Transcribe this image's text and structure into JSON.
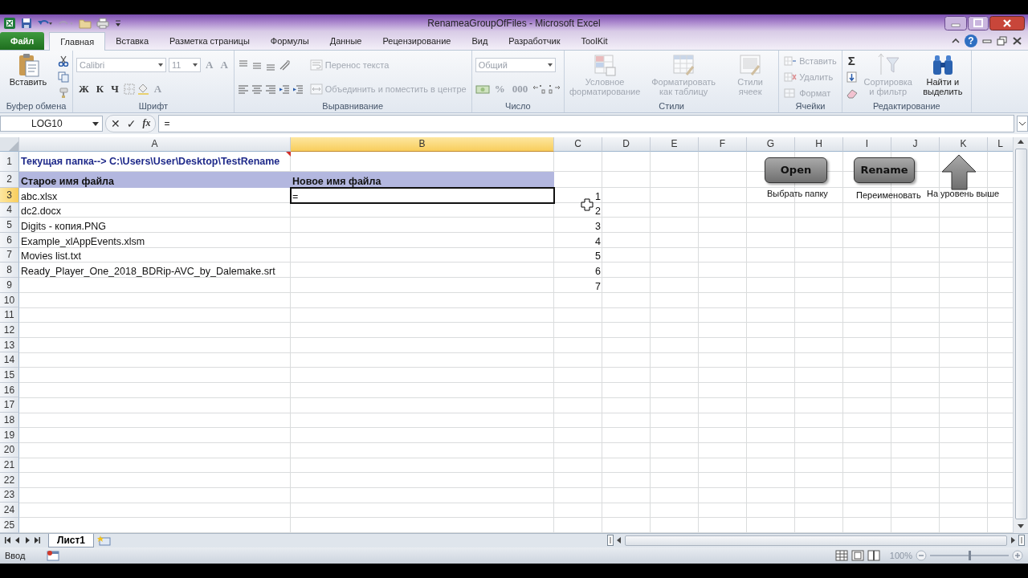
{
  "window": {
    "title": "RenameaGroupOfFiles - Microsoft Excel"
  },
  "ribbon_tabs": [
    {
      "label": "Файл",
      "kind": "file",
      "selected": false
    },
    {
      "label": "Главная",
      "kind": "tab",
      "selected": true
    },
    {
      "label": "Вставка",
      "kind": "tab",
      "selected": false
    },
    {
      "label": "Разметка страницы",
      "kind": "tab",
      "selected": false
    },
    {
      "label": "Формулы",
      "kind": "tab",
      "selected": false
    },
    {
      "label": "Данные",
      "kind": "tab",
      "selected": false
    },
    {
      "label": "Рецензирование",
      "kind": "tab",
      "selected": false
    },
    {
      "label": "Вид",
      "kind": "tab",
      "selected": false
    },
    {
      "label": "Разработчик",
      "kind": "tab",
      "selected": false
    },
    {
      "label": "ToolKit",
      "kind": "tab",
      "selected": false
    }
  ],
  "help_button": "?",
  "ribbon_groups": [
    {
      "label": "Буфер обмена",
      "sections": [
        {
          "kind": "large",
          "label": "Вставить",
          "disabled": false
        },
        {
          "kind": "stack",
          "lines": [
            [
              {
                "kind": "icon"
              }
            ],
            [
              {
                "kind": "icon"
              }
            ],
            [
              {
                "kind": "icon"
              }
            ]
          ]
        }
      ]
    },
    {
      "label": "Шрифт",
      "sections": [
        {
          "kind": "stack",
          "lines": [
            [
              {
                "kind": "combo",
                "value": "Calibri",
                "disabled": true
              },
              {
                "kind": "combo",
                "value": "11",
                "disabled": true
              },
              {
                "kind": "glyph",
                "text": "A",
                "disabled": true
              },
              {
                "kind": "glyph",
                "text": "A",
                "disabled": true
              }
            ],
            [
              {
                "kind": "glyph",
                "text": "Ж",
                "disabled": false
              },
              {
                "kind": "glyph",
                "text": "К",
                "disabled": false
              },
              {
                "kind": "glyph",
                "text": "Ч",
                "disabled": false
              },
              {
                "kind": "icon"
              },
              {
                "kind": "icon"
              },
              {
                "kind": "glyph",
                "text": "A",
                "disabled": true
              }
            ]
          ]
        }
      ]
    },
    {
      "label": "Выравнивание",
      "sections": [
        {
          "kind": "stack",
          "lines": [
            [
              {
                "kind": "icon"
              },
              {
                "kind": "icon"
              },
              {
                "kind": "icon"
              },
              {
                "kind": "icon"
              }
            ],
            [
              {
                "kind": "icon"
              },
              {
                "kind": "icon"
              },
              {
                "kind": "icon"
              },
              {
                "kind": "icon"
              },
              {
                "kind": "icon"
              }
            ]
          ]
        },
        {
          "kind": "stack",
          "lines": [
            [
              {
                "kind": "small",
                "label": "Перенос текста",
                "disabled": true
              }
            ],
            [
              {
                "kind": "small",
                "label": "Объединить и поместить в центре",
                "disabled": true
              }
            ]
          ]
        }
      ]
    },
    {
      "label": "Число",
      "sections": [
        {
          "kind": "stack",
          "lines": [
            [
              {
                "kind": "combo",
                "value": "Общий",
                "disabled": true
              }
            ],
            [
              {
                "kind": "icon"
              },
              {
                "kind": "glyph",
                "text": "%",
                "disabled": true
              },
              {
                "kind": "glyph",
                "text": "000",
                "disabled": true
              },
              {
                "kind": "icon"
              },
              {
                "kind": "icon"
              }
            ]
          ]
        }
      ]
    },
    {
      "label": "Стили",
      "sections": [
        {
          "kind": "large",
          "label": "Условное форматирование",
          "disabled": true
        },
        {
          "kind": "large",
          "label": "Форматировать как таблицу",
          "disabled": true
        },
        {
          "kind": "large",
          "label": "Стили ячеек",
          "disabled": true
        }
      ]
    },
    {
      "label": "Ячейки",
      "sections": [
        {
          "kind": "stack",
          "lines": [
            [
              {
                "kind": "small",
                "label": "Вставить",
                "disabled": true
              }
            ],
            [
              {
                "kind": "small",
                "label": "Удалить",
                "disabled": true
              }
            ],
            [
              {
                "kind": "small",
                "label": "Формат",
                "disabled": true
              }
            ]
          ]
        }
      ]
    },
    {
      "label": "Редактирование",
      "sections": [
        {
          "kind": "stack",
          "lines": [
            [
              {
                "kind": "glyph",
                "text": "Σ",
                "disabled": false
              }
            ],
            [
              {
                "kind": "icon"
              }
            ],
            [
              {
                "kind": "icon"
              }
            ]
          ]
        },
        {
          "kind": "large",
          "label": "Сортировка и фильтр",
          "disabled": true
        },
        {
          "kind": "large",
          "label": "Найти и выделить",
          "disabled": false
        }
      ]
    }
  ],
  "formula_bar": {
    "name_box": "LOG10",
    "cancel": "✕",
    "enter": "✓",
    "function": "fx",
    "value": "="
  },
  "sheet": {
    "columns": [
      {
        "label": "A",
        "selected": false
      },
      {
        "label": "B",
        "selected": true
      },
      {
        "label": "C",
        "selected": false
      },
      {
        "label": "D",
        "selected": false
      },
      {
        "label": "E",
        "selected": false
      },
      {
        "label": "F",
        "selected": false
      },
      {
        "label": "G",
        "selected": false
      },
      {
        "label": "H",
        "selected": false
      },
      {
        "label": "I",
        "selected": false
      },
      {
        "label": "J",
        "selected": false
      },
      {
        "label": "K",
        "selected": false
      },
      {
        "label": "L",
        "selected": false
      }
    ],
    "rows": [
      {
        "header": "1",
        "selected": false,
        "kind": "path",
        "cells": {
          "A": {
            "text": "Текущая папка--> C:\\Users\\User\\Desktop\\TestRename",
            "active": false,
            "comment": true
          }
        }
      },
      {
        "header": "2",
        "selected": false,
        "kind": "heading",
        "cells": {
          "A": {
            "text": "Старое имя файла",
            "active": false,
            "comment": false
          },
          "B": {
            "text": "Новое имя файла",
            "active": false,
            "comment": false
          }
        }
      },
      {
        "header": "3",
        "selected": true,
        "kind": "data",
        "cells": {
          "A": {
            "text": "abc.xlsx",
            "active": false,
            "comment": false
          },
          "B": {
            "text": "=",
            "active": true,
            "comment": false
          },
          "C": {
            "text": "1",
            "active": false,
            "comment": false
          }
        }
      },
      {
        "header": "4",
        "selected": false,
        "kind": "data",
        "cells": {
          "A": {
            "text": "dc2.docx",
            "active": false,
            "comment": false
          },
          "C": {
            "text": "2",
            "active": false,
            "comment": false
          }
        }
      },
      {
        "header": "5",
        "selected": false,
        "kind": "data",
        "cells": {
          "A": {
            "text": "Digits - копия.PNG",
            "active": false,
            "comment": false
          },
          "C": {
            "text": "3",
            "active": false,
            "comment": false
          }
        }
      },
      {
        "header": "6",
        "selected": false,
        "kind": "data",
        "cells": {
          "A": {
            "text": "Example_xlAppEvents.xlsm",
            "active": false,
            "comment": false
          },
          "C": {
            "text": "4",
            "active": false,
            "comment": false
          }
        }
      },
      {
        "header": "7",
        "selected": false,
        "kind": "data",
        "cells": {
          "A": {
            "text": "Movies list.txt",
            "active": false,
            "comment": false
          },
          "C": {
            "text": "5",
            "active": false,
            "comment": false
          }
        }
      },
      {
        "header": "8",
        "selected": false,
        "kind": "data",
        "cells": {
          "A": {
            "text": "Ready_Player_One_2018_BDRip-AVC_by_Dalemake.srt",
            "active": false,
            "comment": false
          },
          "C": {
            "text": "6",
            "active": false,
            "comment": false
          }
        }
      },
      {
        "header": "9",
        "selected": false,
        "kind": "data",
        "cells": {
          "C": {
            "text": "7",
            "active": false,
            "comment": false
          }
        }
      },
      {
        "header": "10",
        "selected": false,
        "kind": "data"
      },
      {
        "header": "11",
        "selected": false,
        "kind": "data"
      },
      {
        "header": "12",
        "selected": false,
        "kind": "data"
      },
      {
        "header": "13",
        "selected": false,
        "kind": "data"
      },
      {
        "header": "14",
        "selected": false,
        "kind": "data"
      },
      {
        "header": "15",
        "selected": false,
        "kind": "data"
      },
      {
        "header": "16",
        "selected": false,
        "kind": "data"
      },
      {
        "header": "17",
        "selected": false,
        "kind": "data"
      },
      {
        "header": "18",
        "selected": false,
        "kind": "data"
      },
      {
        "header": "19",
        "selected": false,
        "kind": "data"
      },
      {
        "header": "20",
        "selected": false,
        "kind": "data"
      },
      {
        "header": "21",
        "selected": false,
        "kind": "data"
      },
      {
        "header": "22",
        "selected": false,
        "kind": "data"
      },
      {
        "header": "23",
        "selected": false,
        "kind": "data"
      },
      {
        "header": "24",
        "selected": false,
        "kind": "data"
      },
      {
        "header": "25",
        "selected": false,
        "kind": "data"
      }
    ]
  },
  "shapes": [
    {
      "kind": "button",
      "label": "Open",
      "caption": "Выбрать папку"
    },
    {
      "kind": "button",
      "label": "Rename",
      "caption": "Переименовать"
    },
    {
      "kind": "arrow",
      "caption": "На уровень выше"
    }
  ],
  "sheet_tabs": [
    {
      "label": "Лист1",
      "selected": true
    }
  ],
  "status_bar": {
    "mode": "Ввод",
    "zoom": {
      "reading": "100%",
      "level": 0.5
    }
  }
}
